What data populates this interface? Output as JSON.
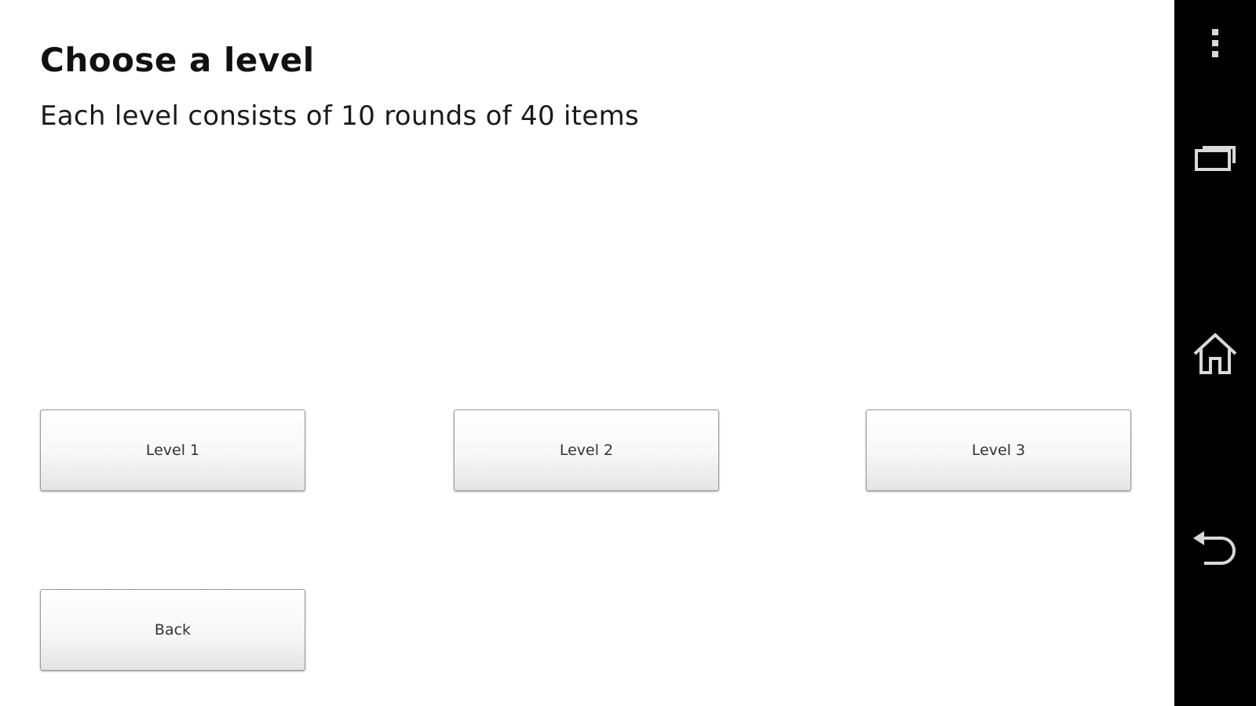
{
  "page": {
    "title": "Choose a level",
    "subtitle": "Each level consists of 10 rounds of 40 items"
  },
  "buttons": {
    "level1": "Level 1",
    "level2": "Level 2",
    "level3": "Level 3",
    "back": "Back"
  },
  "navbar": {
    "icons": [
      "overflow-menu-icon",
      "recent-apps-icon",
      "home-icon",
      "back-icon"
    ],
    "background": "#000000",
    "icon_color": "#d9d9d9"
  }
}
